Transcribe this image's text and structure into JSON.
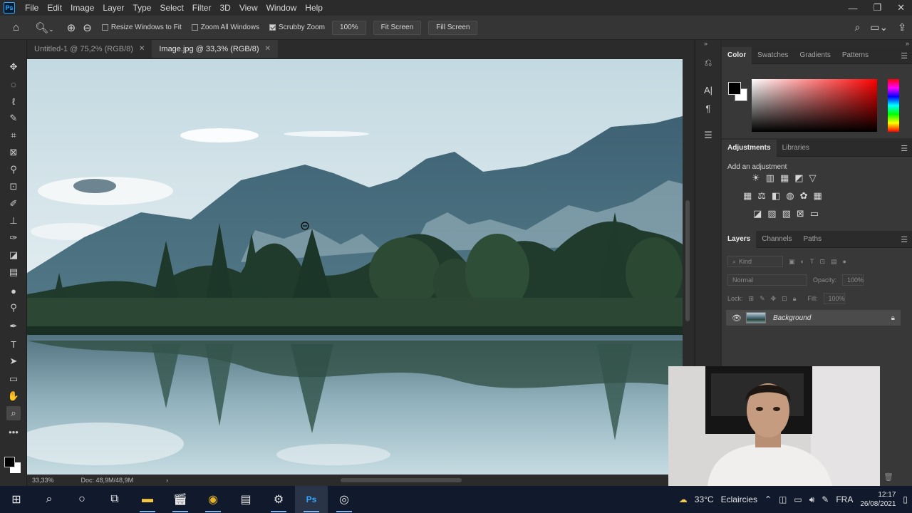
{
  "app": {
    "logo": "Ps"
  },
  "menu": [
    "File",
    "Edit",
    "Image",
    "Layer",
    "Type",
    "Select",
    "Filter",
    "3D",
    "View",
    "Window",
    "Help"
  ],
  "window_controls": {
    "minimize": "—",
    "restore": "❐",
    "close": "✕"
  },
  "options": {
    "resize_windows": "Resize Windows to Fit",
    "zoom_all": "Zoom All Windows",
    "scrubby_zoom": "Scrubby Zoom",
    "zoom_value": "100%",
    "fit_screen": "Fit Screen",
    "fill_screen": "Fill Screen",
    "states": {
      "resize_windows": false,
      "zoom_all": false,
      "scrubby_zoom": true
    }
  },
  "tabs": [
    {
      "label": "Untitled-1 @ 75,2% (RGB/8)",
      "active": false
    },
    {
      "label": "Image.jpg @ 33,3% (RGB/8)",
      "active": true
    }
  ],
  "status": {
    "zoom": "33,33%",
    "doc": "Doc: 48,9M/48,9M"
  },
  "color_panel": {
    "tabs": [
      "Color",
      "Swatches",
      "Gradients",
      "Patterns"
    ],
    "foreground": "#000000",
    "background": "#ffffff"
  },
  "adjustments_panel": {
    "tabs": [
      "Adjustments",
      "Libraries"
    ],
    "add_label": "Add an adjustment"
  },
  "layers_panel": {
    "tabs": [
      "Layers",
      "Channels",
      "Paths"
    ],
    "kind_placeholder": "Kind",
    "blend_mode": "Normal",
    "opacity_label": "Opacity:",
    "opacity_value": "100%",
    "lock_label": "Lock:",
    "fill_label": "Fill:",
    "fill_value": "100%",
    "layers": [
      {
        "name": "Background",
        "visible": true,
        "locked": true
      }
    ]
  },
  "taskbar": {
    "weather_temp": "33°C",
    "weather_text": "Eclaircies",
    "language": "FRA",
    "time": "12:17",
    "date": "26/08/2021"
  },
  "colors": {
    "accent": "#31a8ff",
    "panel": "#383838",
    "taskbar": "#101a2c"
  }
}
